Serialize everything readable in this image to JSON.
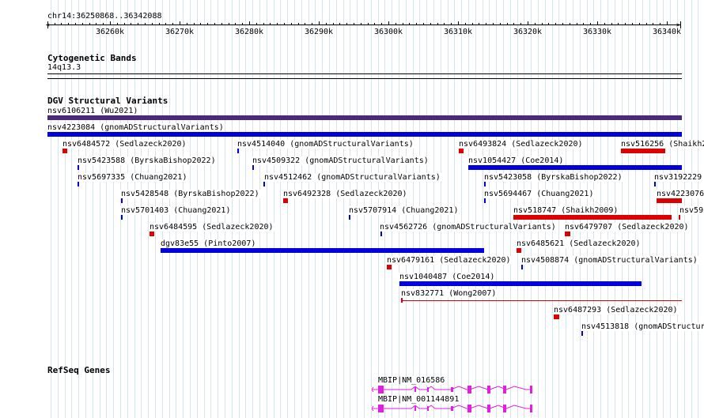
{
  "ruler": {
    "position_label": "chr14:36250868..36342088",
    "ticks": [
      "36260k",
      "36270k",
      "36280k",
      "36290k",
      "36300k",
      "36310k",
      "36320k",
      "36330k",
      "36340k"
    ]
  },
  "tracks": {
    "cytoband": {
      "title": "Cytogenetic Bands",
      "band_label": "14q13.3"
    },
    "dgv": {
      "title": "DGV Structural Variants",
      "features": [
        {
          "label": "nsv6106211 (Wu2021)"
        },
        {
          "label": "nsv4223084 (gnomADStructuralVariants)"
        },
        {
          "label": "nsv6484572 (Sedlazeck2020)"
        },
        {
          "label": "nsv4514040 (gnomADStructuralVariants)"
        },
        {
          "label": "nsv6493824 (Sedlazeck2020)"
        },
        {
          "label": "nsv516256 (Shaikh2"
        },
        {
          "label": "nsv5423588 (ByrskaBishop2022)"
        },
        {
          "label": "nsv4509322 (gnomADStructuralVariants)"
        },
        {
          "label": "nsv1054427 (Coe2014)"
        },
        {
          "label": "nsv5697335 (Chuang2021)"
        },
        {
          "label": "nsv4512462 (gnomADStructuralVariants)"
        },
        {
          "label": "nsv5423058 (ByrskaBishop2022)"
        },
        {
          "label": "nsv3192229"
        },
        {
          "label": "nsv5428548 (ByrskaBishop2022)"
        },
        {
          "label": "nsv6492328 (Sedlazeck2020)"
        },
        {
          "label": "nsv5694467 (Chuang2021)"
        },
        {
          "label": "nsv4223076"
        },
        {
          "label": "nsv5701403 (Chuang2021)"
        },
        {
          "label": "nsv5707914 (Chuang2021)"
        },
        {
          "label": "nsv518747 (Shaikh2009)"
        },
        {
          "label": "nsv593"
        },
        {
          "label": "nsv6484595 (Sedlazeck2020)"
        },
        {
          "label": "nsv4562726 (gnomADStructuralVariants)"
        },
        {
          "label": "nsv6479707 (Sedlazeck2020)"
        },
        {
          "label": "dgv83e55 (Pinto2007)"
        },
        {
          "label": "nsv6485621 (Sedlazeck2020)"
        },
        {
          "label": "nsv6479161 (Sedlazeck2020)"
        },
        {
          "label": "nsv4508874 (gnomADStructuralVariants)"
        },
        {
          "label": "nsv1040487 (Coe2014)"
        },
        {
          "label": "nsv832771 (Wong2007)"
        },
        {
          "label": "nsv6487293 (Sedlazeck2020)"
        },
        {
          "label": "nsv4513818 (gnomADStructur"
        }
      ]
    },
    "refseq": {
      "title": "RefSeq Genes",
      "genes": [
        {
          "label": "MBIP|NM_016586"
        },
        {
          "label": "MBIP|NM_001144891"
        }
      ]
    }
  },
  "colors": {
    "gain": "#0000dd",
    "loss": "#dd0000",
    "complex": "#4b2a7a",
    "gene": "#e020e0",
    "grid": "#d6e4ee"
  }
}
